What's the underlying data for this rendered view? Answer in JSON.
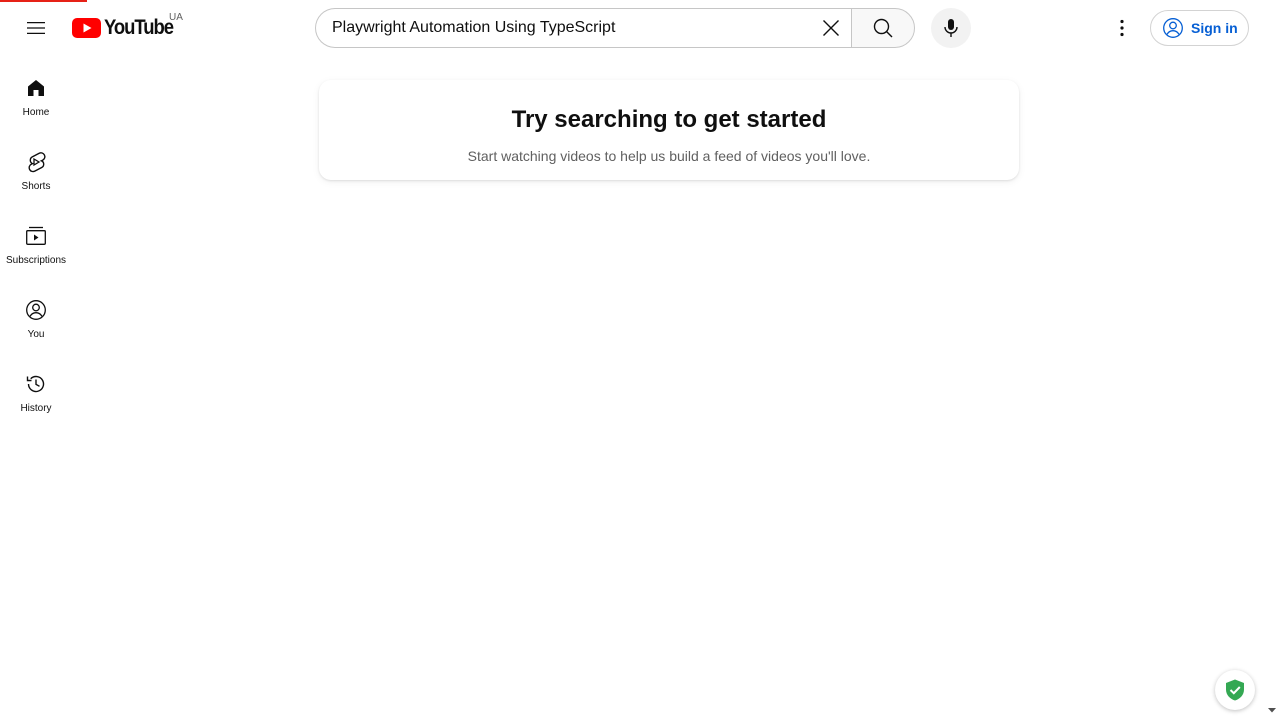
{
  "loading": {
    "progress": 0.068,
    "color": "#e62117"
  },
  "masthead": {
    "menu_icon": "hamburger-menu-icon",
    "logo": {
      "text": "YouTube",
      "country_code": "UA",
      "brand_color": "#ff0000"
    },
    "search": {
      "value": "Playwright Automation Using TypeScript",
      "clear_icon": "close-icon",
      "search_icon": "search-icon"
    },
    "voice_icon": "microphone-icon",
    "more_icon": "more-vertical-icon",
    "sign_in": {
      "label": "Sign in",
      "icon": "account-circle-icon",
      "color": "#065fd4"
    }
  },
  "guide": {
    "items": [
      {
        "label": "Home",
        "icon": "home-icon"
      },
      {
        "label": "Shorts",
        "icon": "shorts-icon"
      },
      {
        "label": "Subscriptions",
        "icon": "subscriptions-icon"
      },
      {
        "label": "You",
        "icon": "account-circle-icon"
      },
      {
        "label": "History",
        "icon": "history-icon"
      }
    ]
  },
  "main": {
    "title": "Try searching to get started",
    "subtitle": "Start watching videos to help us build a feed of videos you'll love."
  },
  "widgets": {
    "shield_icon": "shield-check-icon",
    "shield_color": "#34a853",
    "scroll_icon": "chevron-down-icon"
  }
}
